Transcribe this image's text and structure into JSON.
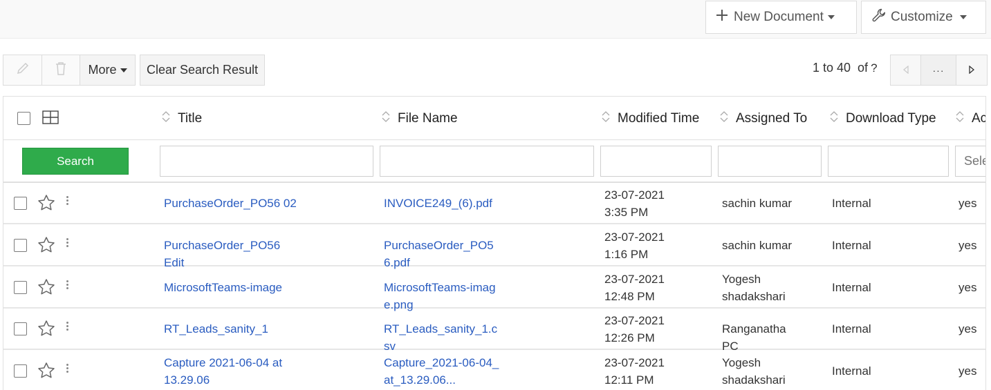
{
  "header": {
    "new_document_label": "New Document",
    "customize_label": "Customize"
  },
  "toolbar": {
    "more_label": "More",
    "clear_search_label": "Clear Search Result",
    "range_text": "1 to 40",
    "of_text": "of",
    "total_unknown": "?",
    "ellipsis": "···"
  },
  "table": {
    "columns": [
      "Title",
      "File Name",
      "Modified Time",
      "Assigned To",
      "Download Type",
      "Ac"
    ],
    "filter": {
      "search_label": "Search",
      "select_placeholder": "Sele"
    },
    "rows": [
      {
        "title": "PurchaseOrder_PO56 02",
        "file_name": "INVOICE249_(6).pdf",
        "modified_date": "23-07-2021",
        "modified_time": "3:35 PM",
        "assigned_to": "sachin kumar",
        "download_type": "Internal",
        "active": "yes"
      },
      {
        "title": "PurchaseOrder_PO56 Edit",
        "file_name": "PurchaseOrder_PO56.pdf",
        "modified_date": "23-07-2021",
        "modified_time": "1:16 PM",
        "assigned_to": "sachin kumar",
        "download_type": "Internal",
        "active": "yes"
      },
      {
        "title": "MicrosoftTeams-image",
        "file_name": "MicrosoftTeams-image.png",
        "modified_date": "23-07-2021",
        "modified_time": "12:48 PM",
        "assigned_to": "Yogesh shadakshari",
        "download_type": "Internal",
        "active": "yes"
      },
      {
        "title": "RT_Leads_sanity_1",
        "file_name": "RT_Leads_sanity_1.csv",
        "modified_date": "23-07-2021",
        "modified_time": "12:26 PM",
        "assigned_to": "Ranganatha PC",
        "download_type": "Internal",
        "active": "yes"
      },
      {
        "title": "Capture 2021-06-04 at 13.29.06",
        "file_name": "Capture_2021-06-04_at_13.29.06...",
        "modified_date": "23-07-2021",
        "modified_time": "12:11 PM",
        "assigned_to": "Yogesh shadakshari",
        "download_type": "Internal",
        "active": "yes"
      }
    ]
  },
  "colors": {
    "link": "#2a5cc0",
    "search_button": "#2fab4b"
  }
}
